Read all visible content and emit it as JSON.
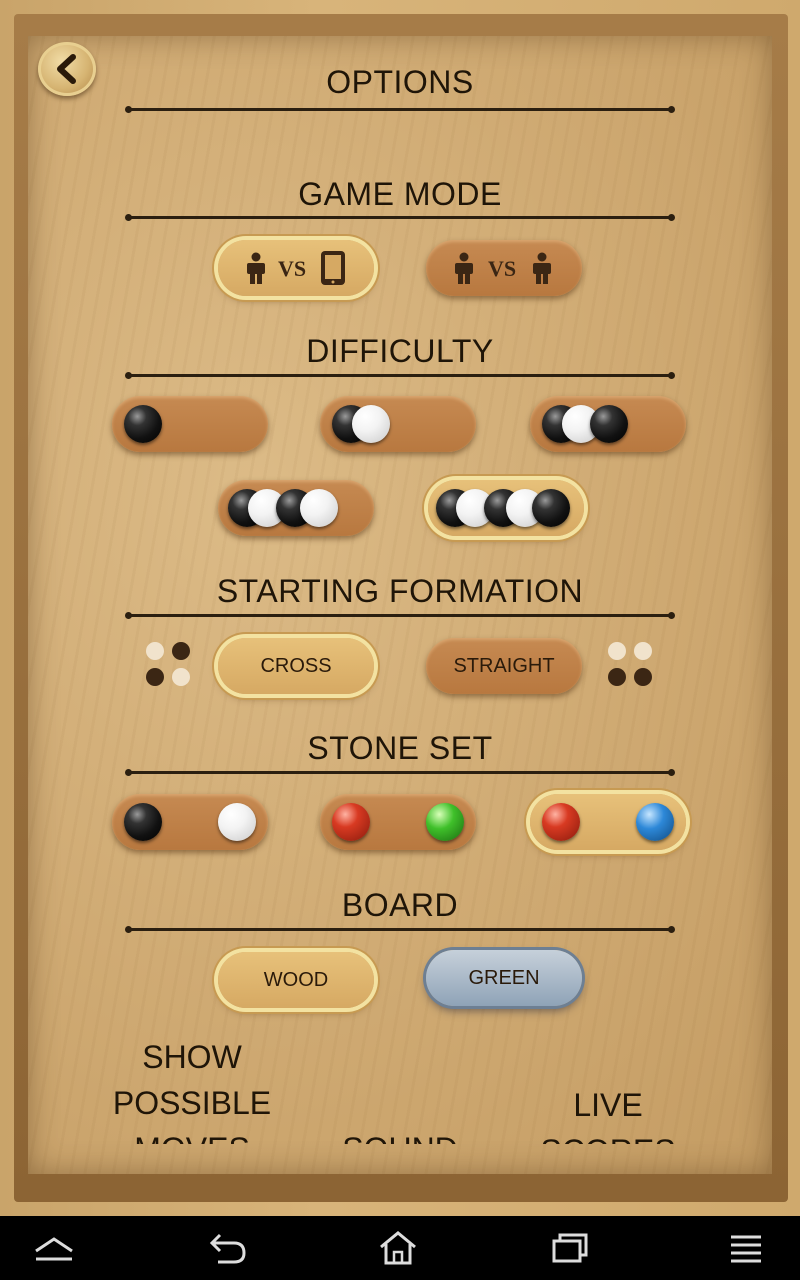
{
  "title": "OPTIONS",
  "sections": {
    "game_mode": "GAME MODE",
    "difficulty": "DIFFICULTY",
    "starting_formation": "STARTING FORMATION",
    "stone_set": "STONE SET",
    "board": "BOARD"
  },
  "game_mode": {
    "vs_label": "VS",
    "options": [
      "human-vs-device",
      "human-vs-human"
    ],
    "selected": "human-vs-device"
  },
  "difficulty": {
    "levels": [
      1,
      2,
      3,
      4,
      5
    ],
    "selected": 5
  },
  "formation": {
    "cross_label": "CROSS",
    "straight_label": "STRAIGHT",
    "selected": "CROSS"
  },
  "stone_set": {
    "options": [
      "black-white",
      "red-green",
      "red-blue"
    ],
    "selected": "red-blue"
  },
  "board": {
    "wood_label": "WOOD",
    "green_label": "GREEN",
    "selected": "WOOD"
  },
  "toggles": {
    "show_moves_line1": "SHOW",
    "show_moves_line2": "POSSIBLE",
    "show_moves_line3": "MOVES",
    "sound_label": "SOUND",
    "live_line1": "LIVE",
    "live_line2": "SCORES"
  },
  "colors": {
    "wood": "#d0ab74",
    "selected_ring": "#f3e2a1",
    "green_button": "#8fa3b7"
  },
  "navbar": {
    "icons": [
      "up-chevron-icon",
      "back-icon",
      "home-icon",
      "recent-apps-icon",
      "menu-icon"
    ]
  }
}
